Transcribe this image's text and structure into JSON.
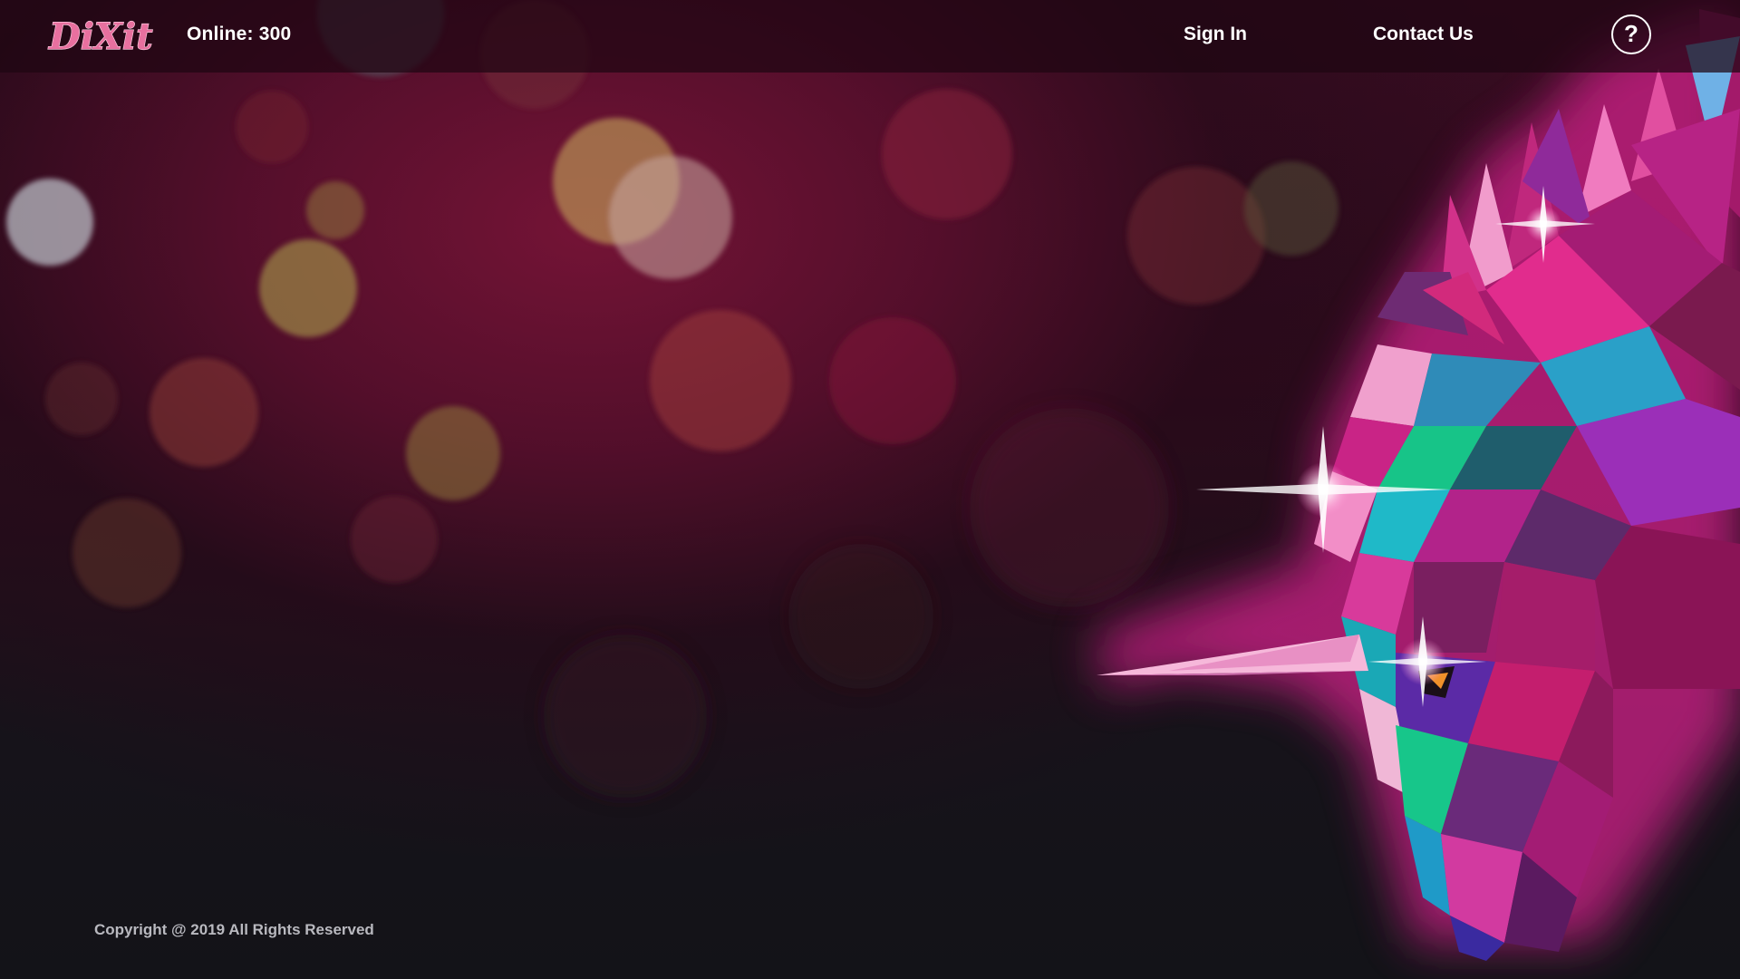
{
  "header": {
    "logo_text": "DiXit",
    "online_label": "Online: 300",
    "nav": {
      "sign_in": "Sign In",
      "contact_us": "Contact Us"
    },
    "help_symbol": "?"
  },
  "footer": {
    "copyright": "Copyright @ 2019 All Rights Reserved"
  },
  "icons": {
    "help": "help-circle-icon"
  },
  "colors": {
    "logo_pink": "#e8709f",
    "background_top": "#3a0c22",
    "background_bottom": "#131318",
    "unicorn_magenta": "#c2187a"
  }
}
